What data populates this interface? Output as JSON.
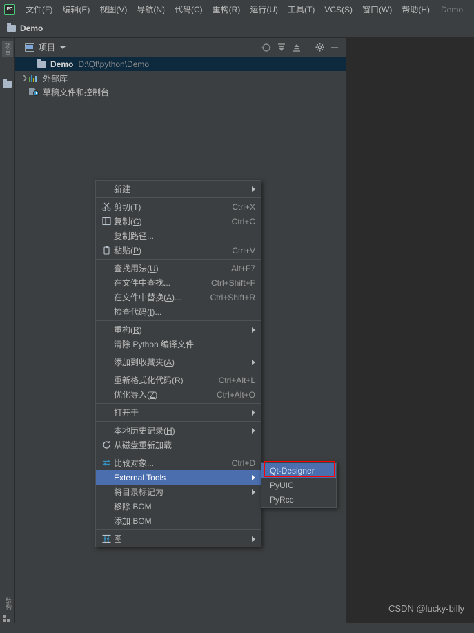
{
  "app": {
    "logo_text": "PC",
    "window_title": "Demo"
  },
  "menubar": {
    "items": [
      {
        "label": "文件(F)",
        "name": "menu-file"
      },
      {
        "label": "编辑(E)",
        "name": "menu-edit"
      },
      {
        "label": "视图(V)",
        "name": "menu-view"
      },
      {
        "label": "导航(N)",
        "name": "menu-navigate"
      },
      {
        "label": "代码(C)",
        "name": "menu-code"
      },
      {
        "label": "重构(R)",
        "name": "menu-refactor"
      },
      {
        "label": "运行(U)",
        "name": "menu-run"
      },
      {
        "label": "工具(T)",
        "name": "menu-tools"
      },
      {
        "label": "VCS(S)",
        "name": "menu-vcs"
      },
      {
        "label": "窗口(W)",
        "name": "menu-window"
      },
      {
        "label": "帮助(H)",
        "name": "menu-help"
      }
    ]
  },
  "breadcrumb": {
    "project": "Demo"
  },
  "toolstrip": {
    "top_tab": "项目",
    "bottom_tab": "结构"
  },
  "project_panel": {
    "title": "项目",
    "tree": [
      {
        "name": "Demo",
        "path": "D:\\Qt\\python\\Demo",
        "selected": true
      },
      {
        "name": "外部库",
        "path": "",
        "selected": false
      },
      {
        "name": "草稿文件和控制台",
        "path": "",
        "selected": false
      }
    ]
  },
  "context_menu": {
    "items": [
      {
        "label": "新建",
        "shortcut": "",
        "icon": "",
        "submenu": true,
        "sep_after": true
      },
      {
        "label": "剪切(T)",
        "underline": "T",
        "shortcut": "Ctrl+X",
        "icon": "scissors-icon",
        "submenu": false
      },
      {
        "label": "复制(C)",
        "underline": "C",
        "shortcut": "Ctrl+C",
        "icon": "copy-icon",
        "submenu": false
      },
      {
        "label": "复制路径...",
        "shortcut": "",
        "icon": "",
        "submenu": false
      },
      {
        "label": "粘贴(P)",
        "underline": "P",
        "shortcut": "Ctrl+V",
        "icon": "clipboard-icon",
        "submenu": false,
        "sep_after": true
      },
      {
        "label": "查找用法(U)",
        "underline": "U",
        "shortcut": "Alt+F7",
        "icon": "",
        "submenu": false
      },
      {
        "label": "在文件中查找...",
        "shortcut": "Ctrl+Shift+F",
        "icon": "",
        "submenu": false
      },
      {
        "label": "在文件中替换(A)...",
        "underline": "A",
        "shortcut": "Ctrl+Shift+R",
        "icon": "",
        "submenu": false
      },
      {
        "label": "检查代码(I)...",
        "underline": "I",
        "shortcut": "",
        "icon": "",
        "submenu": false,
        "sep_after": true
      },
      {
        "label": "重构(R)",
        "underline": "R",
        "shortcut": "",
        "icon": "",
        "submenu": true
      },
      {
        "label": "清除 Python 编译文件",
        "shortcut": "",
        "icon": "",
        "submenu": false,
        "sep_after": true
      },
      {
        "label": "添加到收藏夹(A)",
        "underline": "A",
        "shortcut": "",
        "icon": "",
        "submenu": true,
        "sep_after": true
      },
      {
        "label": "重新格式化代码(R)",
        "underline": "R",
        "shortcut": "Ctrl+Alt+L",
        "icon": "",
        "submenu": false
      },
      {
        "label": "优化导入(Z)",
        "underline": "Z",
        "shortcut": "Ctrl+Alt+O",
        "icon": "",
        "submenu": false,
        "sep_after": true
      },
      {
        "label": "打开于",
        "shortcut": "",
        "icon": "",
        "submenu": true,
        "sep_after": true
      },
      {
        "label": "本地历史记录(H)",
        "underline": "H",
        "shortcut": "",
        "icon": "",
        "submenu": true
      },
      {
        "label": "从磁盘重新加载",
        "shortcut": "",
        "icon": "refresh-icon",
        "submenu": false,
        "sep_after": true
      },
      {
        "label": "比较对象...",
        "shortcut": "Ctrl+D",
        "icon": "compare-icon",
        "submenu": false
      },
      {
        "label": "External Tools",
        "shortcut": "",
        "icon": "",
        "submenu": true,
        "highlighted": true
      },
      {
        "label": "将目录标记为",
        "shortcut": "",
        "icon": "",
        "submenu": true
      },
      {
        "label": "移除 BOM",
        "shortcut": "",
        "icon": "",
        "submenu": false
      },
      {
        "label": "添加 BOM",
        "shortcut": "",
        "icon": "",
        "submenu": false,
        "sep_after": true
      },
      {
        "label": "图",
        "shortcut": "",
        "icon": "diagram-icon",
        "submenu": true
      }
    ]
  },
  "submenu": {
    "items": [
      {
        "label": "Qt-Designer",
        "highlighted": true
      },
      {
        "label": "PyUIC",
        "highlighted": false
      },
      {
        "label": "PyRcc",
        "highlighted": false
      }
    ]
  },
  "watermark": {
    "text": "CSDN @lucky-billy"
  },
  "colors": {
    "panel_bg": "#3c3f41",
    "editor_bg": "#2b2b2b",
    "menu_highlight": "#4b6eaf",
    "tree_selection": "#0d293e",
    "accent_red": "#ff0000",
    "text": "#bbbbbb"
  }
}
